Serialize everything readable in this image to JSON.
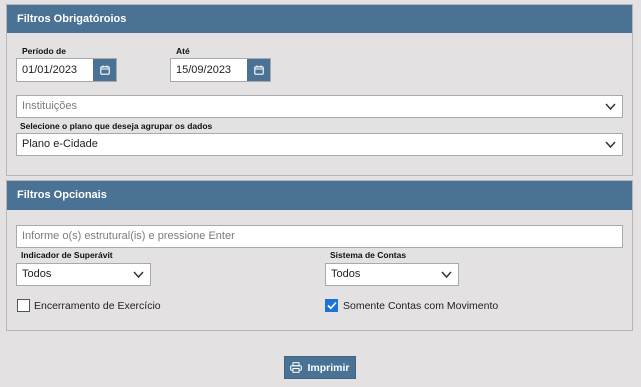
{
  "filtros_obrigatorios": {
    "title": "Filtros Obrigatóroios",
    "periodo_label": "Período de",
    "periodo_value": "01/01/2023",
    "ate_label": "Até",
    "ate_value": "15/09/2023",
    "instituicoes_placeholder": "Instituições",
    "plano_label": "Selecione o plano que deseja agrupar os dados",
    "plano_value": "Plano e-Cidade"
  },
  "filtros_opcionais": {
    "title": "Filtros Opcionais",
    "estrutural_placeholder": "Informe o(s) estrutural(is) e pressione Enter",
    "superavit_label": "Indicador de Superávit",
    "superavit_value": "Todos",
    "sistema_label": "Sistema de Contas",
    "sistema_value": "Todos",
    "encerramento_label": "Encerramento de Exercício",
    "encerramento_checked": false,
    "somente_label": "Somente Contas com Movimento",
    "somente_checked": true
  },
  "actions": {
    "imprimir_label": "Imprimir"
  },
  "colors": {
    "header": "#4a7295",
    "background": "#e3e1e1",
    "checkbox_checked": "#1a73d9"
  },
  "icons": {
    "calendar": "calendar-icon",
    "chevron": "chevron-down-icon",
    "printer": "printer-icon",
    "check": "check-icon"
  }
}
